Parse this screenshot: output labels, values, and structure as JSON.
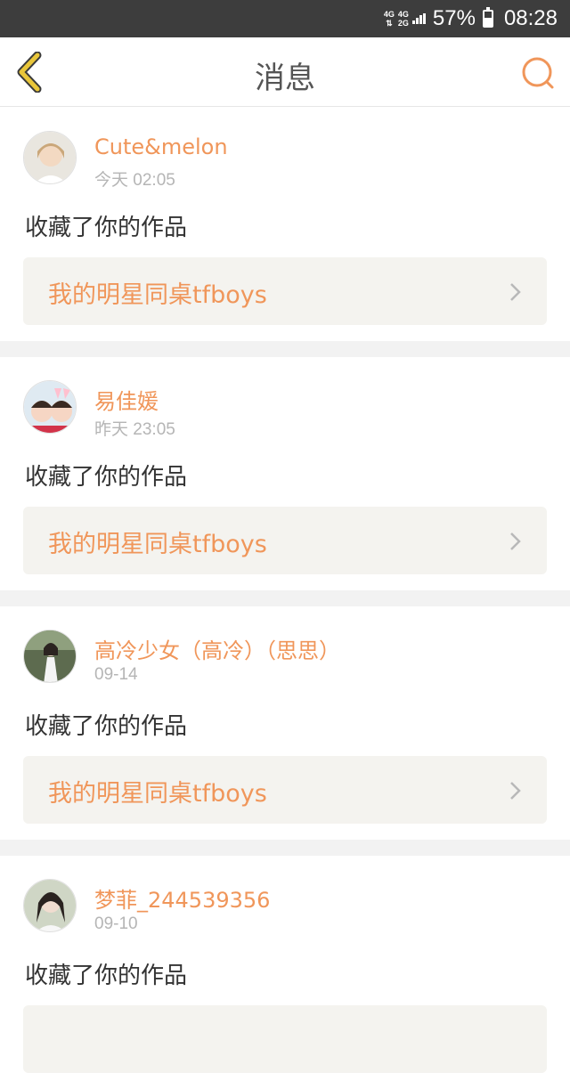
{
  "status": {
    "network_top": "4G",
    "network_bottom": "4G",
    "network_2g": "2G",
    "battery_percent": "57%",
    "time": "08:28",
    "battery_level": 0.57
  },
  "header": {
    "title": "消息",
    "back_icon": "chevron-left-icon",
    "search_icon": "search-icon",
    "accent_color": "#f0965a",
    "back_color": "#e9c63a"
  },
  "messages": [
    {
      "username": "Cute&melon",
      "time": "今天 02:05",
      "action": "收藏了你的作品",
      "work": "我的明星同桌tfboys"
    },
    {
      "username": "易佳媛",
      "time": "昨天 23:05",
      "action": "收藏了你的作品",
      "work": "我的明星同桌tfboys"
    },
    {
      "username": "高冷少女（高冷）（思思）",
      "time": "09-14",
      "action": "收藏了你的作品",
      "work": "我的明星同桌tfboys"
    },
    {
      "username": "梦菲_244539356",
      "time": "09-10",
      "action": "收藏了你的作品",
      "work": ""
    }
  ]
}
